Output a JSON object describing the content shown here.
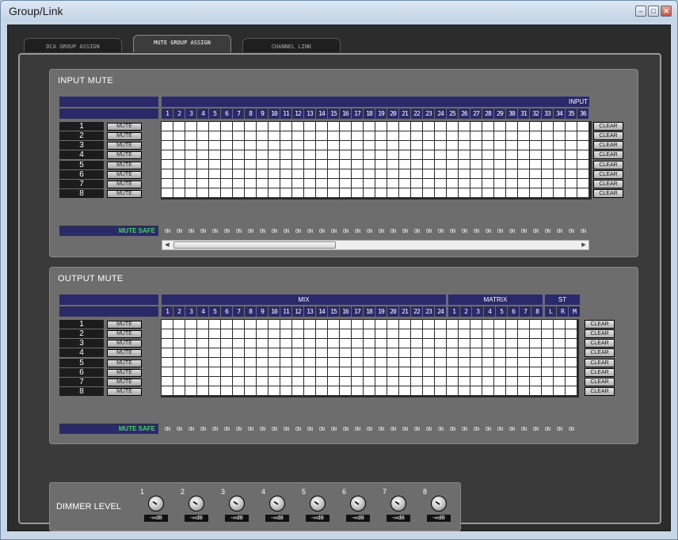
{
  "window": {
    "title": "Group/Link",
    "controls": {
      "minimize": "–",
      "maximize": "□",
      "close": "✕"
    }
  },
  "tabs": [
    {
      "label": "DCA GROUP ASSIGN",
      "active": false
    },
    {
      "label": "MUTE GROUP ASSIGN",
      "active": true
    },
    {
      "label": "CHANNEL LINK",
      "active": false
    }
  ],
  "input_mute": {
    "title": "INPUT MUTE",
    "group_header": "INPUT",
    "channels": [
      "1",
      "2",
      "3",
      "4",
      "5",
      "6",
      "7",
      "8",
      "9",
      "10",
      "11",
      "12",
      "13",
      "14",
      "15",
      "16",
      "17",
      "18",
      "19",
      "20",
      "21",
      "22",
      "23",
      "24",
      "25",
      "26",
      "27",
      "28",
      "29",
      "30",
      "31",
      "32",
      "33",
      "34",
      "35",
      "36"
    ],
    "rows": [
      "1",
      "2",
      "3",
      "4",
      "5",
      "6",
      "7",
      "8"
    ],
    "mute_label": "MUTE",
    "clear_label": "CLEAR",
    "mute_safe_label": "MUTE SAFE",
    "on_label": "ON"
  },
  "output_mute": {
    "title": "OUTPUT MUTE",
    "groups": [
      {
        "label": "MIX",
        "channels": [
          "1",
          "2",
          "3",
          "4",
          "5",
          "6",
          "7",
          "8",
          "9",
          "10",
          "11",
          "12",
          "13",
          "14",
          "15",
          "16",
          "17",
          "18",
          "19",
          "20",
          "21",
          "22",
          "23",
          "24"
        ]
      },
      {
        "label": "MATRIX",
        "channels": [
          "1",
          "2",
          "3",
          "4",
          "5",
          "6",
          "7",
          "8"
        ]
      },
      {
        "label": "ST",
        "channels": [
          "L",
          "R",
          "M"
        ]
      }
    ],
    "rows": [
      "1",
      "2",
      "3",
      "4",
      "5",
      "6",
      "7",
      "8"
    ],
    "mute_label": "MUTE",
    "clear_label": "CLEAR",
    "mute_safe_label": "MUTE SAFE",
    "on_label": "ON"
  },
  "dimmer": {
    "label": "DIMMER LEVEL",
    "knobs": [
      {
        "num": "1",
        "value": "-∞dB"
      },
      {
        "num": "2",
        "value": "-∞dB"
      },
      {
        "num": "3",
        "value": "-∞dB"
      },
      {
        "num": "4",
        "value": "-∞dB"
      },
      {
        "num": "5",
        "value": "-∞dB"
      },
      {
        "num": "6",
        "value": "-∞dB"
      },
      {
        "num": "7",
        "value": "-∞dB"
      },
      {
        "num": "8",
        "value": "-∞dB"
      }
    ]
  },
  "scrollbar": {
    "left_arrow": "◀",
    "right_arrow": "▶",
    "position": 0.0
  }
}
